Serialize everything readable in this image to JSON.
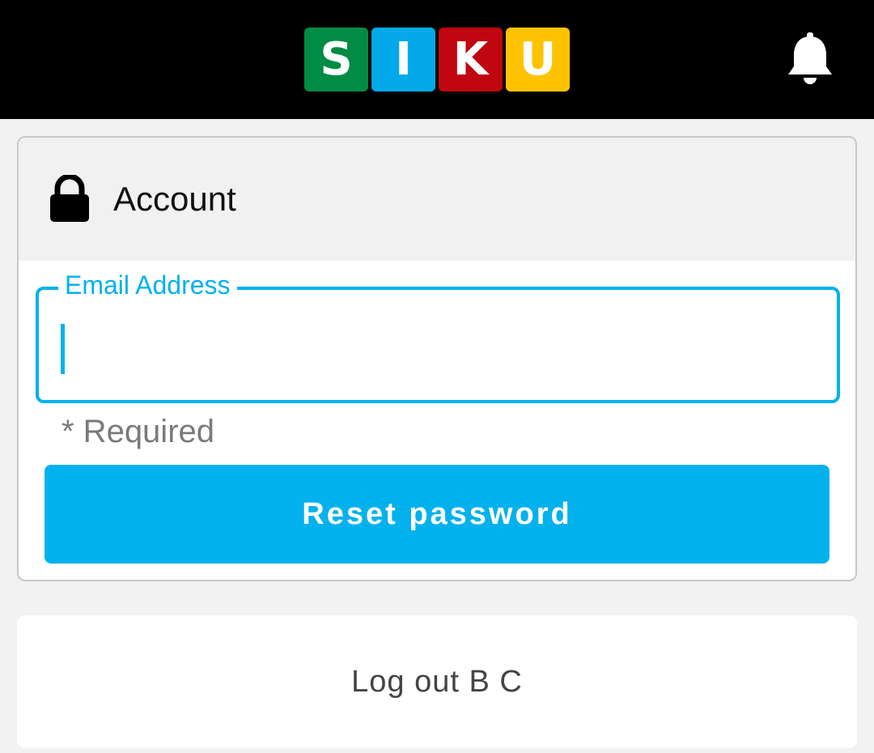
{
  "header": {
    "logo_letters": [
      {
        "letter": "S",
        "color": "#018b43"
      },
      {
        "letter": "I",
        "color": "#03a9e8"
      },
      {
        "letter": "K",
        "color": "#c00610"
      },
      {
        "letter": "U",
        "color": "#fec300"
      }
    ],
    "notification_icon": "bell-icon"
  },
  "account": {
    "icon": "lock-icon",
    "title": "Account",
    "email_field": {
      "label": "Email Address",
      "value": ""
    },
    "helper_text": "* Required",
    "reset_button_label": "Reset password"
  },
  "logout": {
    "label": "Log out B C"
  },
  "colors": {
    "accent": "#03b1ec",
    "topbar": "#000000",
    "background": "#f2f2f2"
  }
}
